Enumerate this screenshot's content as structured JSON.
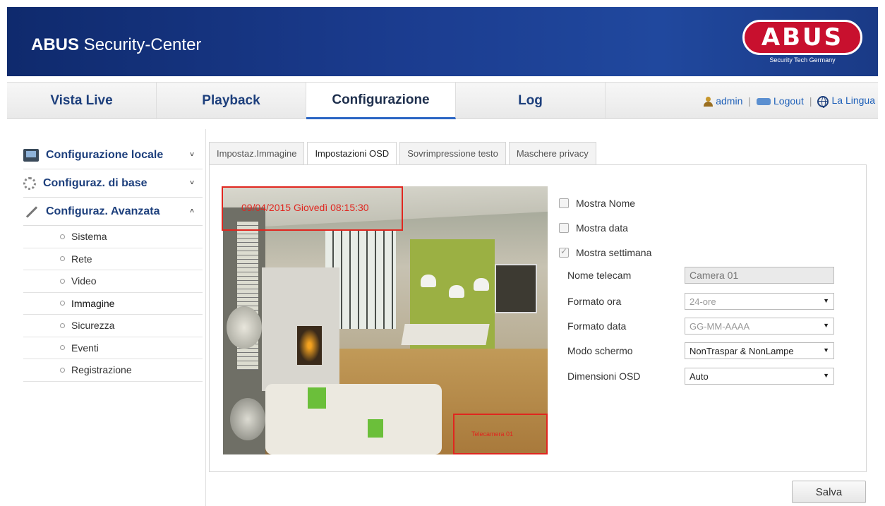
{
  "header": {
    "brand_bold": "ABUS",
    "brand_rest": " Security-Center",
    "logo_text": "ABUS",
    "logo_tagline": "Security Tech Germany"
  },
  "nav": {
    "tabs": [
      "Vista Live",
      "Playback",
      "Configurazione",
      "Log"
    ],
    "active_tab": "Configurazione",
    "user": "admin",
    "logout": "Logout",
    "language": "La Lingua",
    "separator": "|"
  },
  "sidebar": {
    "sections": [
      {
        "label": "Configurazione locale",
        "icon": "monitor-icon",
        "state": "collapsed"
      },
      {
        "label": "Configuraz. di base",
        "icon": "gear-icon",
        "state": "collapsed"
      },
      {
        "label": "Configuraz. Avanzata",
        "icon": "wrench-icon",
        "state": "expanded"
      }
    ],
    "items": [
      "Sistema",
      "Rete",
      "Video",
      "Immagine",
      "Sicurezza",
      "Eventi",
      "Registrazione"
    ],
    "active_item": "Immagine",
    "chevron_down": "˅",
    "chevron_up": "˄"
  },
  "tabs": [
    "Impostaz.Immagine",
    "Impostazioni OSD",
    "Sovrimpressione testo",
    "Maschere privacy"
  ],
  "active_tab": "Impostazioni OSD",
  "preview": {
    "osd_datetime": "09/04/2015 Giovedì 08:15:30",
    "osd_camera_label": "Telecamera 01"
  },
  "osd_settings": {
    "checkboxes": [
      {
        "label": "Mostra Nome",
        "checked": false
      },
      {
        "label": "Mostra data",
        "checked": false
      },
      {
        "label": "Mostra settimana",
        "checked": true
      }
    ],
    "fields": {
      "camera_name_label": "Nome telecam",
      "camera_name_value": "Camera 01",
      "time_format_label": "Formato ora",
      "time_format_value": "24-ore",
      "date_format_label": "Formato data",
      "date_format_value": "GG-MM-AAAA",
      "display_mode_label": "Modo schermo",
      "display_mode_value": "NonTraspar & NonLampe",
      "osd_size_label": "Dimensioni OSD",
      "osd_size_value": "Auto"
    }
  },
  "save_label": "Salva",
  "colors": {
    "header_bg": "#1b3c8f",
    "nav_text": "#1d3f7c",
    "osd_red": "#e0261f",
    "logo_red": "#c8102e",
    "active_underline": "#2b66c4"
  }
}
